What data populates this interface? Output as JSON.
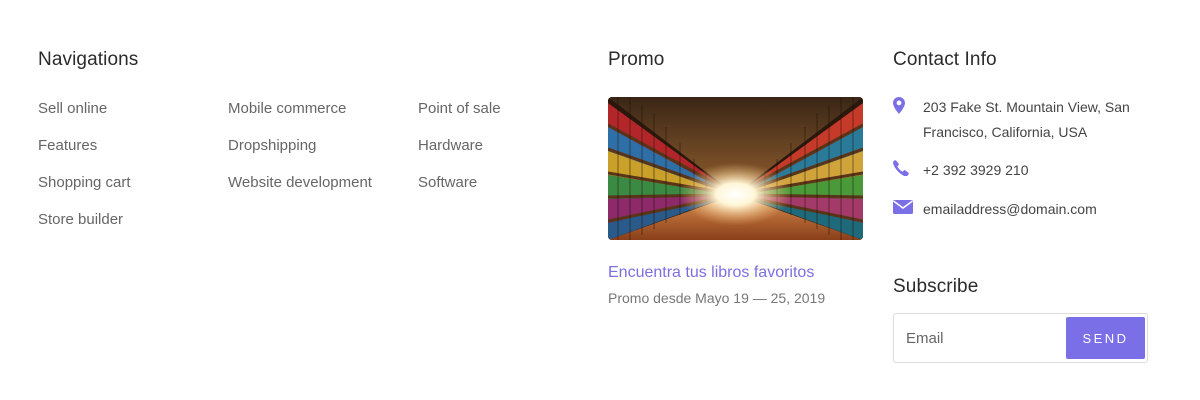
{
  "navigations": {
    "title": "Navigations",
    "columns": [
      [
        "Sell online",
        "Features",
        "Shopping cart",
        "Store builder"
      ],
      [
        "Mobile commerce",
        "Dropshipping",
        "Website development"
      ],
      [
        "Point of sale",
        "Hardware",
        "Software"
      ]
    ]
  },
  "promo": {
    "title": "Promo",
    "image_icon": "library-bookshelves-image",
    "link": "Encuentra tus libros favoritos",
    "date": "Promo desde Mayo 19 — 25, 2019"
  },
  "contact": {
    "title": "Contact Info",
    "address": "203 Fake St. Mountain View, San Francisco, California, USA",
    "phone": "+2 392 3929 210",
    "email": "emailaddress@domain.com",
    "icons": [
      "map-marker-icon",
      "phone-icon",
      "envelope-icon"
    ],
    "icon_color": "#7b6fe8"
  },
  "subscribe": {
    "title": "Subscribe",
    "placeholder": "Email",
    "button": "SEND",
    "accent": "#7b6fe8"
  }
}
